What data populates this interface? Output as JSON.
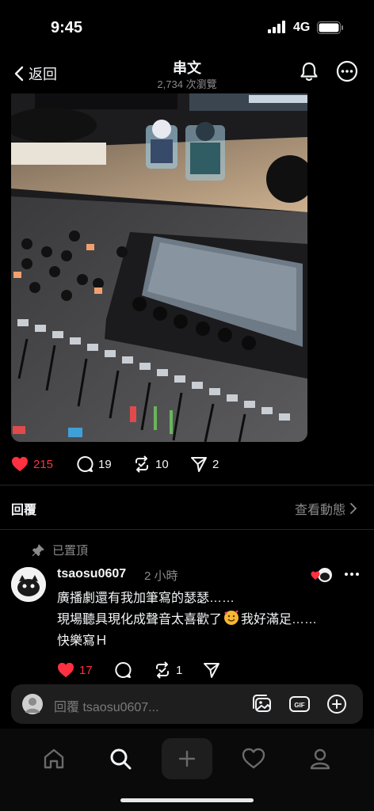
{
  "status": {
    "time": "9:45",
    "network": "4G"
  },
  "header": {
    "back_label": "返回",
    "title": "串文",
    "views": "2,734 次瀏覽"
  },
  "post": {
    "likes": "215",
    "comments": "19",
    "reposts": "10",
    "shares": "2"
  },
  "section": {
    "replies_label": "回覆",
    "activity_label": "查看動態"
  },
  "reply": {
    "pinned_label": "已置頂",
    "username": "tsaosu0607",
    "time": "2 小時",
    "line1": "廣播劇還有我加筆寫的瑟瑟……",
    "line2a": "現場聽具現化成聲音太喜歡了",
    "line2b": "我好滿足……",
    "line3": "快樂寫Ｈ",
    "likes": "17",
    "reposts": "1"
  },
  "composer": {
    "placeholder": "回覆 tsaosu0607..."
  },
  "colors": {
    "like_red": "#ff3040",
    "bg": "#000000",
    "muted": "#8a8a8a"
  }
}
